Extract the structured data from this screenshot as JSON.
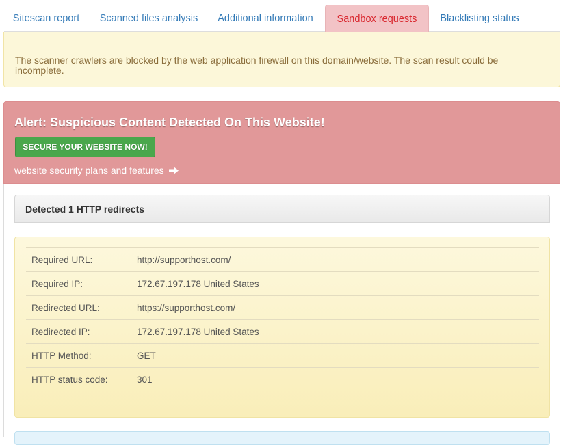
{
  "tabs": [
    {
      "label": "Sitescan report",
      "active": false
    },
    {
      "label": "Scanned files analysis",
      "active": false
    },
    {
      "label": "Additional information",
      "active": false
    },
    {
      "label": "Sandbox requests",
      "active": true
    },
    {
      "label": "Blacklisting status",
      "active": false
    }
  ],
  "notice": {
    "text": "The scanner crawlers are blocked by the web application firewall on this domain/website. The scan result could be incomplete."
  },
  "alert": {
    "title": "Alert: Suspicious Content Detected On This Website!",
    "button_label": "SECURE YOUR WEBSITE NOW!",
    "link_text": "website security plans and features",
    "link_icon": "arrow-right-icon"
  },
  "redirects": {
    "heading": "Detected 1 HTTP redirects",
    "rows": [
      {
        "label": "Required URL:",
        "value": "http://supporthost.com/"
      },
      {
        "label": "Required IP:",
        "value": "172.67.197.178 United States"
      },
      {
        "label": "Redirected URL:",
        "value": "https://supporthost.com/"
      },
      {
        "label": "Redirected IP:",
        "value": "172.67.197.178 United States"
      },
      {
        "label": "HTTP Method:",
        "value": "GET"
      },
      {
        "label": "HTTP status code:",
        "value": "301"
      }
    ]
  },
  "colors": {
    "link": "#337ab7",
    "active_tab_bg": "#f2c3c6",
    "active_tab_text": "#d9272e",
    "notice_bg": "#fcf7d9",
    "alert_bg": "#e19899",
    "button_green": "#4aa74c"
  }
}
